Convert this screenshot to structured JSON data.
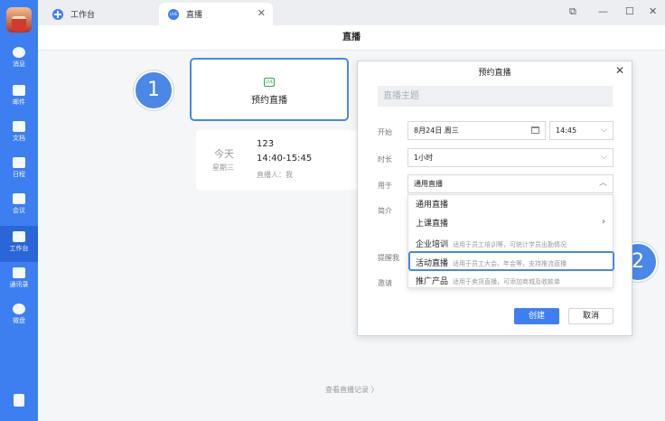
{
  "sidebar": {
    "items": [
      {
        "label": "消息",
        "icon": "chat-icon"
      },
      {
        "label": "邮件",
        "icon": "mail-icon"
      },
      {
        "label": "文档",
        "icon": "doc-icon"
      },
      {
        "label": "日程",
        "icon": "calendar-icon"
      },
      {
        "label": "会议",
        "icon": "meeting-icon"
      },
      {
        "label": "工作台",
        "icon": "workbench-icon"
      },
      {
        "label": "通讯录",
        "icon": "contacts-icon"
      },
      {
        "label": "微盘",
        "icon": "drive-icon"
      }
    ]
  },
  "tabs": [
    {
      "label": "工作台"
    },
    {
      "label": "直播",
      "badge": "LIVE"
    }
  ],
  "page": {
    "title": "直播",
    "reserve_card": {
      "label": "预约直播",
      "icon_text": "LIVE"
    },
    "live_item": {
      "day": "今天",
      "weekday": "星期三",
      "name": "123",
      "time": "14:40-15:45",
      "host": "直播人：我"
    },
    "history_link": "查看直播记录  〉"
  },
  "callouts": [
    "1",
    "2"
  ],
  "dialog": {
    "title": "预约直播",
    "topic_placeholder": "直播主题",
    "labels": {
      "start": "开始",
      "duration": "时长",
      "purpose": "用于",
      "intro": "简介",
      "remind": "提醒我",
      "invite": "邀请"
    },
    "start_date": "8月24日 周三",
    "start_time": "14:45",
    "duration": "1小时",
    "purpose": "通用直播",
    "dropdown": [
      {
        "label": "通用直播",
        "desc": ""
      },
      {
        "label": "上课直播",
        "desc": ""
      },
      {
        "label": "企业培训",
        "desc": "适用于员工培训等，可统计学员出勤情况"
      },
      {
        "label": "活动直播",
        "desc": "适用于员工大会、年会等，支持推流直播"
      },
      {
        "label": "推广产品",
        "desc": "适用于卖货直播，可添加商城及收款单"
      }
    ],
    "create_label": "创建",
    "cancel_label": "取消"
  },
  "colors": {
    "accent": "#3d7ff0",
    "highlight": "#4a87e6"
  }
}
